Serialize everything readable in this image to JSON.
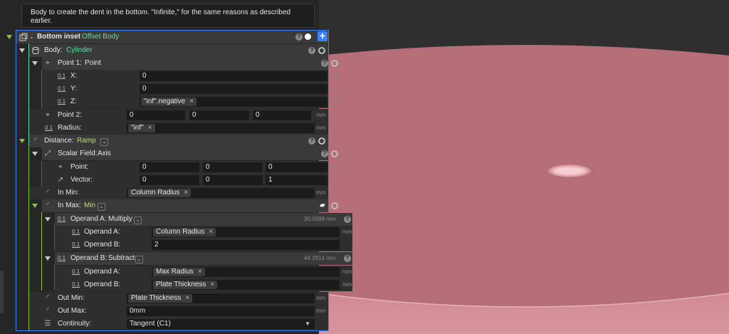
{
  "description": "Body to create the dent in the bottom. \"Infinite,\" for the same reasons as described earlier.",
  "unit": "mm",
  "root": {
    "label": "Bottom inset",
    "type": "Offset Body"
  },
  "body": {
    "label": "Body:",
    "type": "Cylinder",
    "point1": {
      "label": "Point 1:",
      "type": "Point",
      "x_label": "X:",
      "x": "0",
      "y_label": "Y:",
      "y": "0",
      "z_label": "Z:",
      "z": "\"inf\".negative"
    },
    "point2": {
      "label": "Point 2:",
      "values": [
        "0",
        "0",
        "0"
      ]
    },
    "radius": {
      "label": "Radius:",
      "value": "\"inf\""
    }
  },
  "distance": {
    "label": "Distance:",
    "type": "Ramp",
    "scalar_field": {
      "label": "Scalar Field:",
      "type": "Axis",
      "point_label": "Point:",
      "point": [
        "0",
        "0",
        "0"
      ],
      "vector_label": "Vector:",
      "vector": [
        "0",
        "0",
        "1"
      ]
    },
    "in_min": {
      "label": "In Min:",
      "value": "Column Radius"
    },
    "in_max": {
      "label": "In Max:",
      "type": "Min",
      "operand_a": {
        "label": "Operand A:",
        "type": "Multiply",
        "result": "30.0688 mm",
        "a_label": "Operand A:",
        "a": "Column Radius",
        "b_label": "Operand B:",
        "b": "2"
      },
      "operand_b": {
        "label": "Operand B:",
        "type": "Subtract",
        "result": "44.2914 mm",
        "a_label": "Operand A:",
        "a": "Max Radius",
        "b_label": "Operand B:",
        "b": "Plate Thickness"
      }
    },
    "out_min": {
      "label": "Out Min:",
      "value": "Plate Thickness"
    },
    "out_max": {
      "label": "Out Max:",
      "value": "0mm"
    },
    "continuity": {
      "label": "Continuity:",
      "value": "Tangent (C1)"
    }
  },
  "icons": {
    "help": "?",
    "remove": "×",
    "add": "+",
    "numeric": "0.1"
  },
  "colors": {
    "accent": "#3b82f6",
    "type_green": "#5fe0a5",
    "type_yellow_green": "#b7e05f",
    "shape": "#c47a84"
  }
}
